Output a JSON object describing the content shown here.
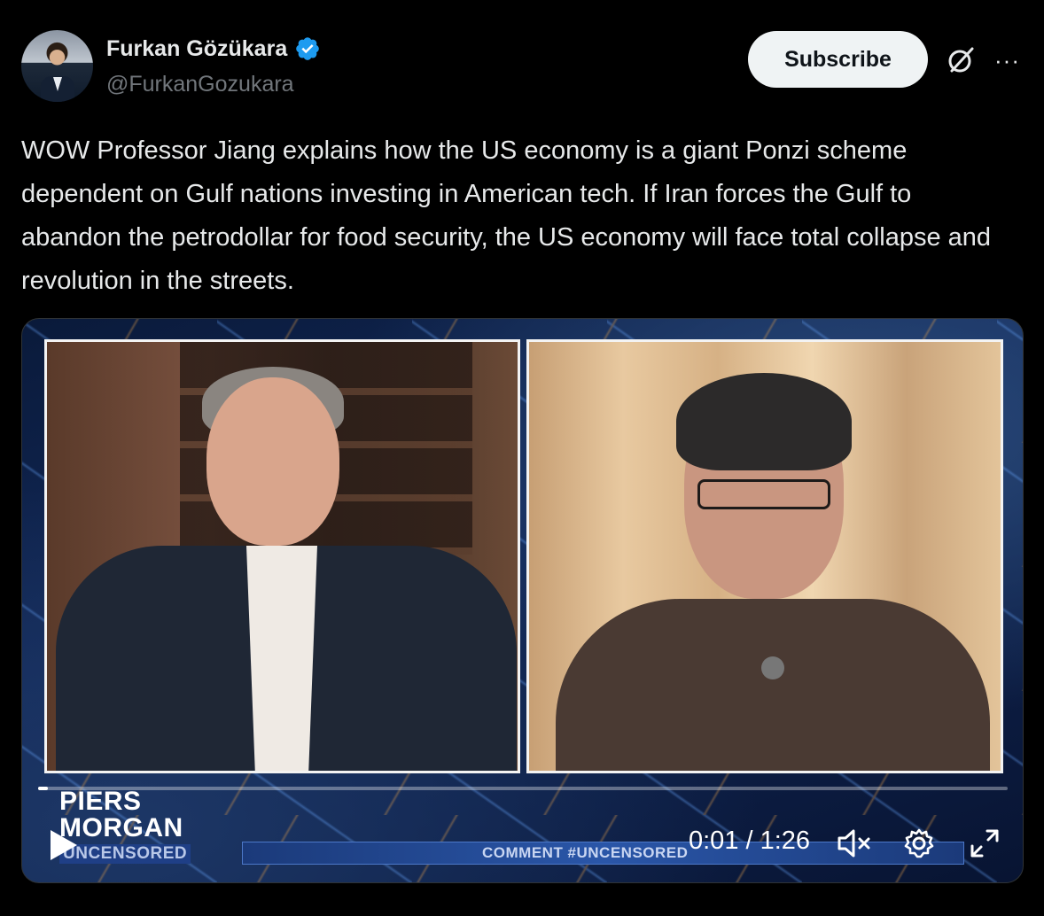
{
  "author": {
    "name": "Furkan Gözükara",
    "handle": "@FurkanGozukara",
    "verified": true
  },
  "actions": {
    "subscribe_label": "Subscribe",
    "grok_icon": "grok-icon",
    "more_icon": "more-icon",
    "more_label": "···"
  },
  "tweet": {
    "text": "WOW Professor Jiang explains how the US economy is a giant Ponzi scheme dependent on Gulf nations investing in American tech. If Iran forces the Gulf to abandon the petrodollar for food security, the US economy will face total collapse and revolution in the streets."
  },
  "video": {
    "brand_line1": "PIERS",
    "brand_line2": "MORGAN",
    "brand_line3": "UNCENSORED",
    "ticker": "COMMENT #UNCENSORED",
    "time": "0:01 / 1:26",
    "progress": 0.01,
    "muted": true
  },
  "colors": {
    "accent": "#1d9bf0",
    "background": "#000000",
    "text": "#e7e9ea",
    "muted_text": "#71767b"
  }
}
